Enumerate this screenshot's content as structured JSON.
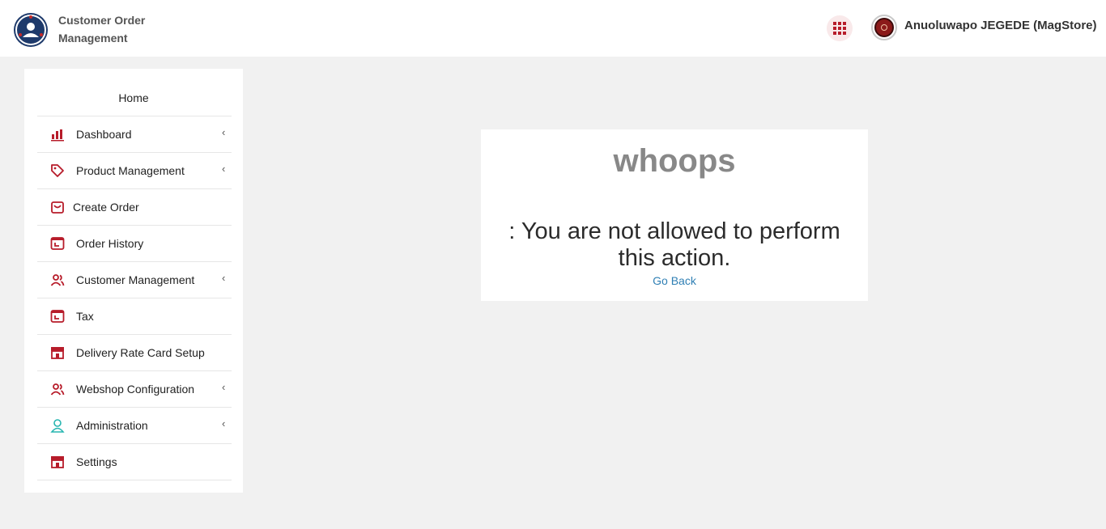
{
  "header": {
    "app_title": "Customer Order Management",
    "user_name": "Anuoluwapo JEGEDE (MagStore)",
    "accent_color": "#b71c2a",
    "logo_color": "#1e3a6b"
  },
  "sidebar": {
    "home_label": "Home",
    "items": [
      {
        "label": "Dashboard",
        "icon": "bar-chart-icon",
        "has_submenu": true
      },
      {
        "label": "Product Management",
        "icon": "tag-icon",
        "has_submenu": true
      },
      {
        "label": "Create Order",
        "icon": "shopping-bag-icon",
        "has_submenu": false
      },
      {
        "label": "Order History",
        "icon": "calendar-icon",
        "has_submenu": false
      },
      {
        "label": "Customer Management",
        "icon": "users-icon",
        "has_submenu": true
      },
      {
        "label": "Tax",
        "icon": "calendar-icon",
        "has_submenu": false
      },
      {
        "label": "Delivery Rate Card Setup",
        "icon": "store-icon",
        "has_submenu": false
      },
      {
        "label": "Webshop Configuration",
        "icon": "users-icon",
        "has_submenu": true
      },
      {
        "label": "Administration",
        "icon": "user-icon",
        "has_submenu": true
      },
      {
        "label": "Settings",
        "icon": "store-icon",
        "has_submenu": false
      }
    ],
    "chevron": "‹"
  },
  "error": {
    "title": "whoops",
    "message": ": You are not allowed to perform this action.",
    "link_label": "Go Back"
  }
}
